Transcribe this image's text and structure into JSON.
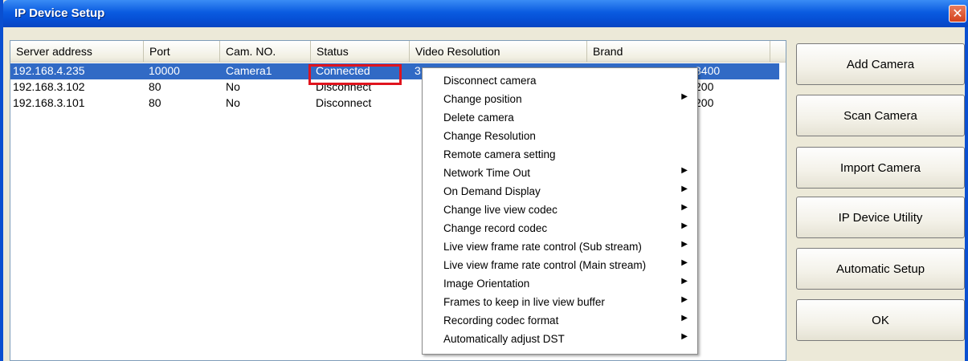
{
  "window": {
    "title": "IP Device Setup",
    "close_glyph": "✕"
  },
  "list": {
    "columns": [
      "Server address",
      "Port",
      "Cam. NO.",
      "Status",
      "Video Resolution",
      "Brand"
    ],
    "rows": [
      {
        "server": "192.168.4.235",
        "port": "10000",
        "cam": "Camera1",
        "status": "Connected",
        "resolution": "3",
        "brand": "",
        "tail": "8400"
      },
      {
        "server": "192.168.3.102",
        "port": "80",
        "cam": "No",
        "status": "Disconnect",
        "resolution": "",
        "brand": "",
        "tail": "200"
      },
      {
        "server": "192.168.3.101",
        "port": "80",
        "cam": "No",
        "status": "Disconnect",
        "resolution": "",
        "brand": "",
        "tail": "200"
      }
    ],
    "selected_row_color": "#316ac5",
    "highlight_color": "#e0141e"
  },
  "context_menu": {
    "items": [
      {
        "label": "Disconnect camera",
        "submenu": false
      },
      {
        "label": "Change position",
        "submenu": true
      },
      {
        "label": "Delete camera",
        "submenu": false
      },
      {
        "label": "Change Resolution",
        "submenu": false
      },
      {
        "label": "Remote camera setting",
        "submenu": false
      },
      {
        "label": "Network Time Out",
        "submenu": true
      },
      {
        "label": "On Demand Display",
        "submenu": true
      },
      {
        "label": "Change live view codec",
        "submenu": true
      },
      {
        "label": "Change record codec",
        "submenu": true
      },
      {
        "label": "Live view frame rate control (Sub stream)",
        "submenu": true
      },
      {
        "label": "Live view frame rate control (Main stream)",
        "submenu": true
      },
      {
        "label": "Image Orientation",
        "submenu": true
      },
      {
        "label": "Frames to keep in live view buffer",
        "submenu": true
      },
      {
        "label": "Recording codec format",
        "submenu": true
      },
      {
        "label": "Automatically adjust DST",
        "submenu": true
      }
    ],
    "arrow_glyph": "▶"
  },
  "buttons": {
    "add_camera": "Add Camera",
    "scan_camera": "Scan Camera",
    "import_camera": "Import Camera",
    "ip_device_utility": "IP Device Utility",
    "automatic_setup": "Automatic Setup",
    "ok": "OK"
  }
}
